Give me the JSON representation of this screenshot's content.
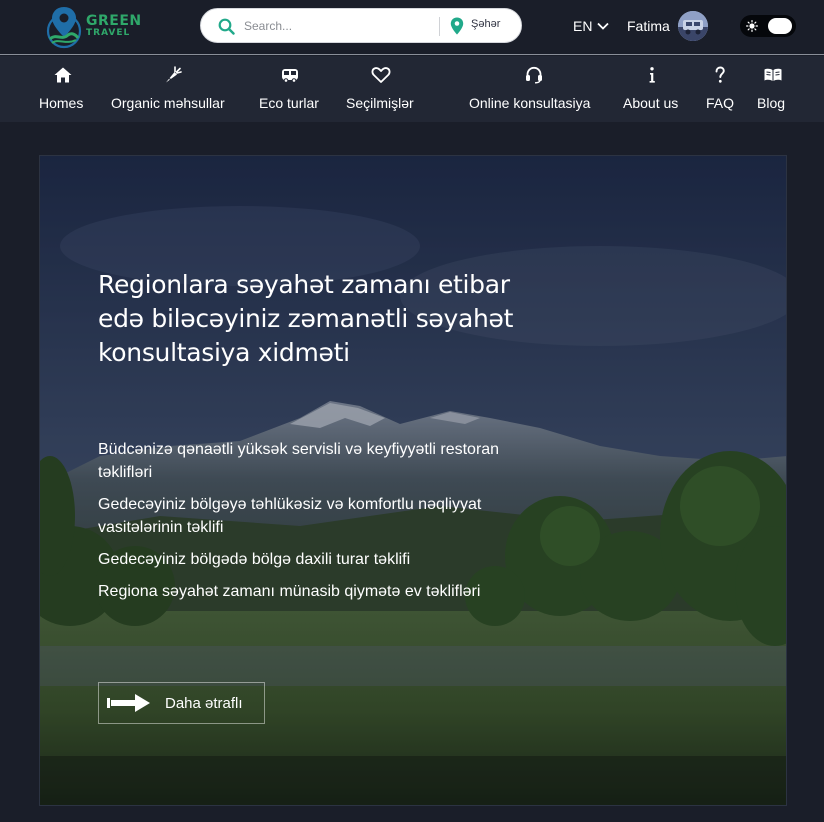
{
  "header": {
    "logo": {
      "line1": "GREEN",
      "line2": "TRAVEL"
    },
    "search": {
      "placeholder": "Search...",
      "city": "Şəhər"
    },
    "language": "EN",
    "user": {
      "name": "Fatima"
    },
    "theme_toggle": {
      "icon": "sun-icon",
      "state": "light"
    }
  },
  "nav": {
    "items": [
      {
        "label": "Homes",
        "icon": "home-icon"
      },
      {
        "label": "Organic məhsullar",
        "icon": "carrot-icon"
      },
      {
        "label": "Eco turlar",
        "icon": "bus-icon"
      },
      {
        "label": "Seçilmişlər",
        "icon": "heart-icon"
      },
      {
        "label": "Online konsultasiya",
        "icon": "headset-icon"
      },
      {
        "label": "About us",
        "icon": "info-icon"
      },
      {
        "label": "FAQ",
        "icon": "question-icon"
      },
      {
        "label": "Blog",
        "icon": "book-icon"
      }
    ]
  },
  "hero": {
    "title": "Regionlara səyahət zamanı etibar edə biləcəyiniz zəmanətli səyahət konsultasiya xidməti",
    "bullets": [
      "Büdcənizə qənaətli yüksək servisli və keyfiyyətli restoran təklifləri",
      "Gedecəyiniz bölgəyə təhlükəsiz və komfortlu nəqliyyat vasitələrinin təklifi",
      "Gedecəyiniz bölgədə bölgə daxili turar təklifi",
      "Regiona səyahət zamanı münasib qiymətə ev təklifləri"
    ],
    "button_label": "Daha ətraflı"
  },
  "colors": {
    "background": "#1a1e29",
    "nav_background": "#222734",
    "brand_green": "#2fa86a",
    "search_accent": "#21a98a"
  }
}
